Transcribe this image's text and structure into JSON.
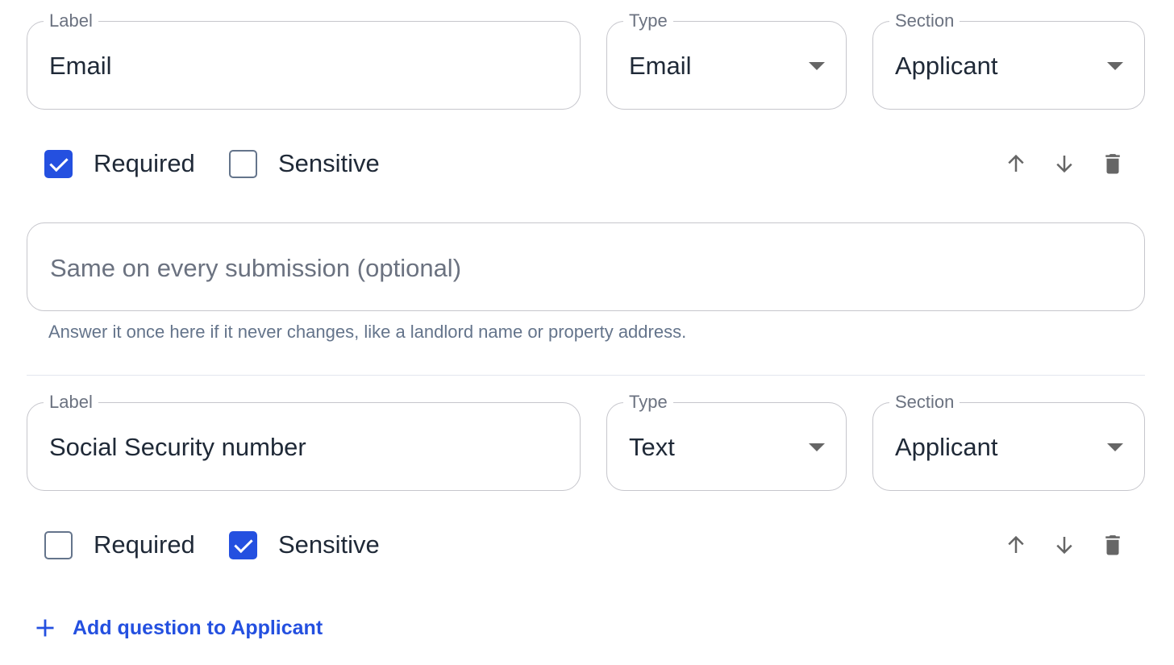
{
  "questions": [
    {
      "label_legend": "Label",
      "label_value": "Email",
      "type_legend": "Type",
      "type_value": "Email",
      "section_legend": "Section",
      "section_value": "Applicant",
      "required_label": "Required",
      "required_checked": true,
      "sensitive_label": "Sensitive",
      "sensitive_checked": false,
      "default_placeholder": "Same on every submission (optional)",
      "default_helper": "Answer it once here if it never changes, like a landlord name or property address."
    },
    {
      "label_legend": "Label",
      "label_value": "Social Security number",
      "type_legend": "Type",
      "type_value": "Text",
      "section_legend": "Section",
      "section_value": "Applicant",
      "required_label": "Required",
      "required_checked": false,
      "sensitive_label": "Sensitive",
      "sensitive_checked": true
    }
  ],
  "add_question_label": "Add question to Applicant",
  "icons": {
    "move_up": "arrow-up-icon",
    "move_down": "arrow-down-icon",
    "delete": "trash-icon",
    "add": "plus-icon"
  },
  "colors": {
    "accent": "#2450e0",
    "border": "#c6c6cc",
    "muted_text": "#6b7280"
  }
}
